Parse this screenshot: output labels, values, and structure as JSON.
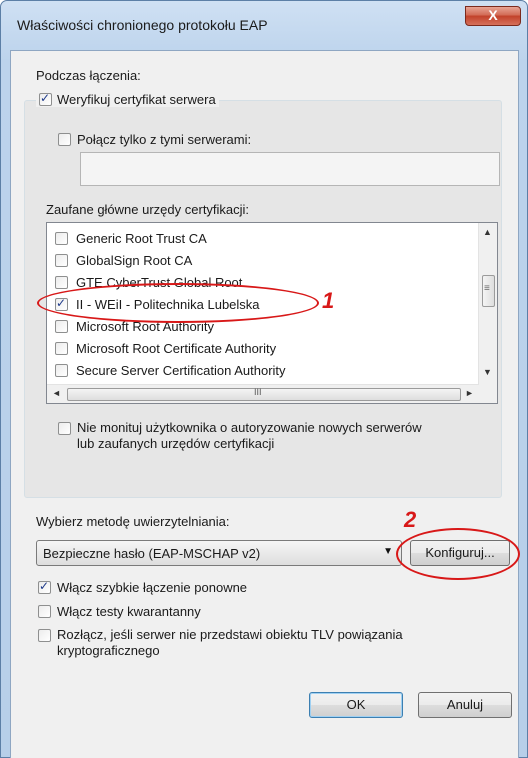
{
  "window": {
    "title": "Właściwości chronionego protokołu EAP",
    "close_glyph": "X"
  },
  "section_connect": {
    "label": "Podczas łączenia:",
    "verify_cert": {
      "label": "Weryfikuj certyfikat serwera",
      "checked": true
    },
    "connect_servers": {
      "label": "Połącz tylko z tymi serwerami:",
      "checked": false,
      "value": ""
    },
    "trusted_ca_label": "Zaufane główne urzędy certyfikacji:",
    "ca_list": [
      {
        "label": "Generic Root Trust CA",
        "checked": false
      },
      {
        "label": "GlobalSign Root CA",
        "checked": false
      },
      {
        "label": "GTE CyberTrust Global Root",
        "checked": false
      },
      {
        "label": "II - WEiI - Politechnika Lubelska",
        "checked": true
      },
      {
        "label": "Microsoft Root Authority",
        "checked": false
      },
      {
        "label": "Microsoft Root Certificate Authority",
        "checked": false
      },
      {
        "label": "Secure Server Certification Authority",
        "checked": false
      }
    ],
    "no_prompt": {
      "label_line1": "Nie monituj użytkownika o autoryzowanie nowych serwerów",
      "label_line2": "lub zaufanych urzędów certyfikacji",
      "checked": false
    }
  },
  "auth_method": {
    "label": "Wybierz metodę uwierzytelniania:",
    "selected": "Bezpieczne hasło (EAP-MSCHAP v2)",
    "configure_label": "Konfiguruj..."
  },
  "options": {
    "fast_reconnect": {
      "label": "Włącz szybkie łączenie ponowne",
      "checked": true
    },
    "quarantine": {
      "label": "Włącz testy kwarantanny",
      "checked": false
    },
    "disconnect_tlv": {
      "label_line1": "Rozłącz, jeśli serwer nie przedstawi obiektu TLV powiązania",
      "label_line2": "kryptograficznego",
      "checked": false
    }
  },
  "buttons": {
    "ok": "OK",
    "cancel": "Anuluj"
  },
  "annotations": {
    "marker1": "1",
    "marker2": "2",
    "color": "#d81818"
  },
  "scroll_glyphs": {
    "up": "▲",
    "down": "▼",
    "left": "◄",
    "right": "►",
    "h_grip": "III",
    "v_grip": "≡"
  }
}
